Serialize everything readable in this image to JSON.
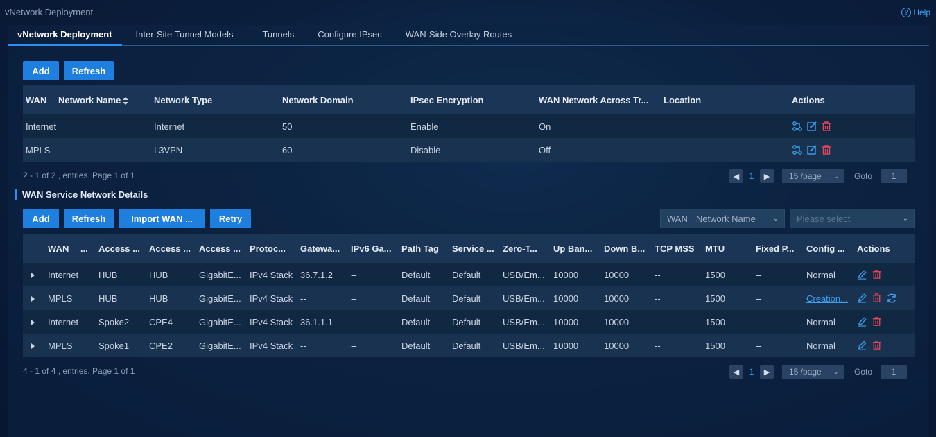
{
  "app": {
    "title": "vNetwork Deployment",
    "help_label": "Help"
  },
  "tabs": [
    {
      "label": "vNetwork Deployment",
      "active": true
    },
    {
      "label": "Inter-Site Tunnel Models"
    },
    {
      "label": "Tunnels"
    },
    {
      "label": "Configure IPsec"
    },
    {
      "label": "WAN-Side Overlay Routes"
    }
  ],
  "top_toolbar": {
    "add_label": "Add",
    "refresh_label": "Refresh"
  },
  "top_table": {
    "headers": [
      "WAN",
      "Network Name",
      "Network Type",
      "Network Domain",
      "IPsec Encryption",
      "WAN Network Across Tr...",
      "Location",
      "Actions"
    ],
    "rows": [
      {
        "wan": "Internet",
        "network_name": "",
        "network_type": "Internet",
        "network_domain": "50",
        "ipsec": "Enable",
        "across": "On",
        "location": ""
      },
      {
        "wan": "MPLS",
        "network_name": "",
        "network_type": "L3VPN",
        "network_domain": "60",
        "ipsec": "Disable",
        "across": "Off",
        "location": ""
      }
    ],
    "footer": "2 - 1 of 2 , entries. Page 1 of 1",
    "pager": {
      "page": "1",
      "per_page": "15 /page",
      "goto_label": "Goto",
      "goto_value": "1"
    }
  },
  "section": {
    "title": "WAN Service Network Details"
  },
  "bottom_toolbar": {
    "add_label": "Add",
    "refresh_label": "Refresh",
    "import_label": "Import WAN ...",
    "retry_label": "Retry",
    "filter_field_label": "WAN",
    "filter_field_value": "Network Name",
    "filter_placeholder": "Please select"
  },
  "bottom_table": {
    "headers": [
      "WAN",
      "...",
      "Access ...",
      "Access ...",
      "Access ...",
      "Protoc...",
      "Gatewa...",
      "IPv6 Ga...",
      "Path Tag",
      "Service ...",
      "Zero-T...",
      "Up Ban...",
      "Down B...",
      "TCP MSS",
      "MTU",
      "Fixed P...",
      "Config ...",
      "Actions"
    ],
    "rows": [
      {
        "wan": "Internet",
        "access1": "HUB",
        "access2": "HUB",
        "access3": "GigabitE...",
        "protocol": "IPv4 Stack",
        "gateway": "36.7.1.2",
        "ipv6": "--",
        "path_tag": "Default",
        "service": "Default",
        "zero": "USB/Em...",
        "up": "10000",
        "down": "10000",
        "tcp": "--",
        "mtu": "1500",
        "fixed": "--",
        "config": "Normal",
        "config_is_link": false,
        "has_retry": false
      },
      {
        "wan": "MPLS",
        "access1": "HUB",
        "access2": "HUB",
        "access3": "GigabitE...",
        "protocol": "IPv4 Stack",
        "gateway": "--",
        "ipv6": "--",
        "path_tag": "Default",
        "service": "Default",
        "zero": "USB/Em...",
        "up": "10000",
        "down": "10000",
        "tcp": "--",
        "mtu": "1500",
        "fixed": "--",
        "config": "Creation...",
        "config_is_link": true,
        "has_retry": true
      },
      {
        "wan": "Internet",
        "access1": "Spoke2",
        "access2": "CPE4",
        "access3": "GigabitE...",
        "protocol": "IPv4 Stack",
        "gateway": "36.1.1.1",
        "ipv6": "--",
        "path_tag": "Default",
        "service": "Default",
        "zero": "USB/Em...",
        "up": "10000",
        "down": "10000",
        "tcp": "--",
        "mtu": "1500",
        "fixed": "--",
        "config": "Normal",
        "config_is_link": false,
        "has_retry": false
      },
      {
        "wan": "MPLS",
        "access1": "Spoke1",
        "access2": "CPE2",
        "access3": "GigabitE...",
        "protocol": "IPv4 Stack",
        "gateway": "--",
        "ipv6": "--",
        "path_tag": "Default",
        "service": "Default",
        "zero": "USB/Em...",
        "up": "10000",
        "down": "10000",
        "tcp": "--",
        "mtu": "1500",
        "fixed": "--",
        "config": "Normal",
        "config_is_link": false,
        "has_retry": false
      }
    ],
    "footer": "4 - 1 of 4 , entries. Page 1 of 1",
    "pager": {
      "page": "1",
      "per_page": "15 /page",
      "goto_label": "Goto",
      "goto_value": "1"
    }
  },
  "colors": {
    "accent": "#1e7fdf",
    "link": "#3fa0f0",
    "danger": "#e8455a"
  },
  "icons": [
    "help-icon",
    "sort-icon",
    "topology-icon",
    "edit-icon",
    "delete-icon",
    "retry-icon",
    "expand-icon",
    "chevron-down-icon",
    "chevron-left-icon",
    "chevron-right-icon"
  ]
}
